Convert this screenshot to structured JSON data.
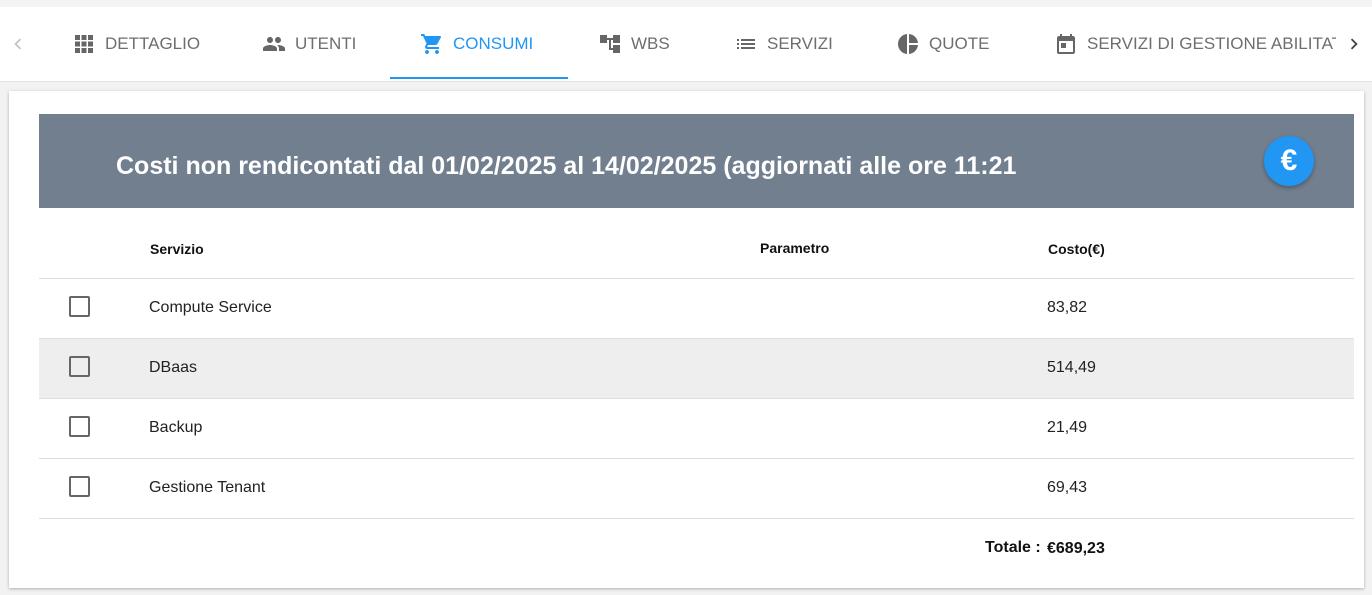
{
  "tabs": [
    {
      "label": "DETTAGLIO",
      "icon": "grid-icon"
    },
    {
      "label": "UTENTI",
      "icon": "users-icon"
    },
    {
      "label": "CONSUMI",
      "icon": "cart-icon",
      "active": true
    },
    {
      "label": "WBS",
      "icon": "hierarchy-icon"
    },
    {
      "label": "SERVIZI",
      "icon": "list-icon"
    },
    {
      "label": "QUOTE",
      "icon": "pie-icon"
    },
    {
      "label": "SERVIZI DI GESTIONE ABILITATI",
      "icon": "calendar-icon"
    }
  ],
  "colors": {
    "accent": "#2196f3",
    "banner": "#717f8f"
  },
  "banner": {
    "title": "Costi non rendicontati dal 01/02/2025 al 14/02/2025 (aggiornati alle ore 11:21",
    "action_icon": "euro-icon",
    "action_symbol": "€"
  },
  "table": {
    "headers": {
      "service": "Servizio",
      "parameter": "Parametro",
      "cost": "Costo(€)"
    },
    "rows": [
      {
        "service": "Compute Service",
        "parameter": "",
        "cost": "83,82",
        "checked": false
      },
      {
        "service": "DBaas",
        "parameter": "",
        "cost": "514,49",
        "checked": false
      },
      {
        "service": "Backup",
        "parameter": "",
        "cost": "21,49",
        "checked": false
      },
      {
        "service": "Gestione Tenant",
        "parameter": "",
        "cost": "69,43",
        "checked": false
      }
    ],
    "total_label": "Totale :",
    "total_value": "€689,23"
  }
}
